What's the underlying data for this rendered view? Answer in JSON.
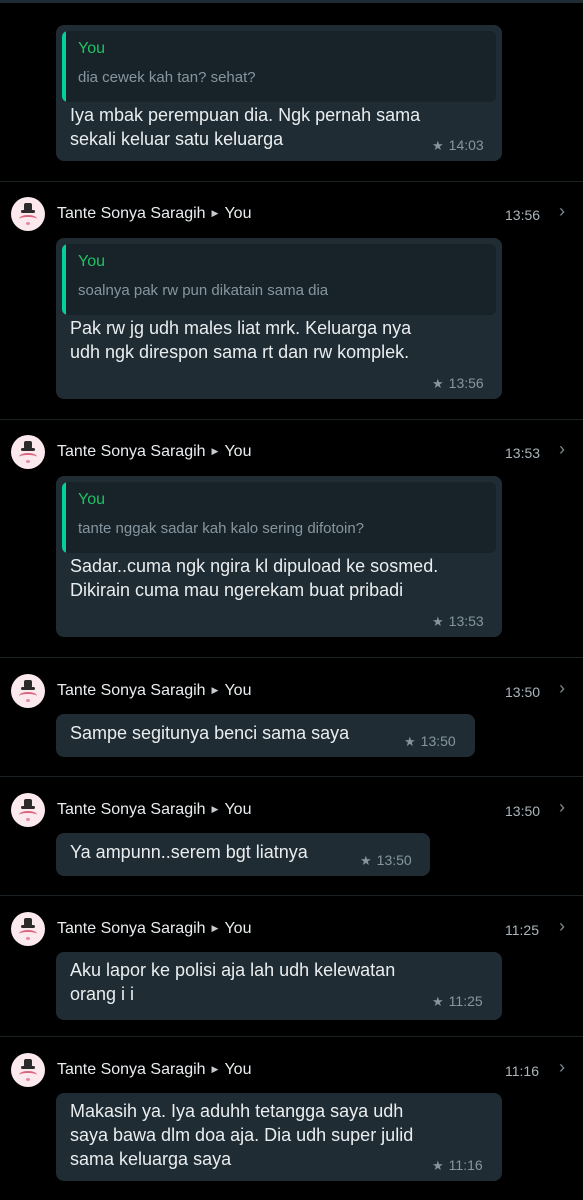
{
  "top_message": {
    "quote_name": "You",
    "quote_text": "dia cewek kah tan? sehat?",
    "text_lines": [
      "Iya mbak perempuan dia. Ngk pernah sama",
      "sekali keluar satu keluarga"
    ],
    "time": "14:03"
  },
  "messages": [
    {
      "sender": "Tante Sonya Saragih",
      "recipient": "You",
      "header_time": "13:56",
      "quote_name": "You",
      "quote_text": "soalnya pak rw pun dikatain sama dia",
      "text_lines": [
        "Pak rw jg udh males liat mrk. Keluarga nya",
        "udh ngk direspon sama rt dan rw komplek."
      ],
      "time": "13:56"
    },
    {
      "sender": "Tante Sonya Saragih",
      "recipient": "You",
      "header_time": "13:53",
      "quote_name": "You",
      "quote_text": "tante nggak sadar kah kalo sering difotoin?",
      "text_lines": [
        "Sadar..cuma ngk ngira kl dipuload ke sosmed.",
        "Dikirain cuma mau ngerekam buat pribadi"
      ],
      "time": "13:53"
    },
    {
      "sender": "Tante Sonya Saragih",
      "recipient": "You",
      "header_time": "13:50",
      "text_lines": [
        "Sampe segitunya benci sama saya"
      ],
      "time": "13:50"
    },
    {
      "sender": "Tante Sonya Saragih",
      "recipient": "You",
      "header_time": "13:50",
      "text_lines": [
        "Ya ampunn..serem bgt liatnya"
      ],
      "time": "13:50"
    },
    {
      "sender": "Tante Sonya Saragih",
      "recipient": "You",
      "header_time": "11:25",
      "text_lines": [
        "Aku lapor ke polisi aja lah udh kelewatan",
        "orang i i"
      ],
      "time": "11:25"
    },
    {
      "sender": "Tante Sonya Saragih",
      "recipient": "You",
      "header_time": "11:16",
      "text_lines": [
        "Makasih ya. Iya aduhh tetangga saya udh",
        "saya bawa dlm doa aja. Dia udh super julid",
        "sama keluarga saya"
      ],
      "time": "11:16"
    }
  ],
  "icons": {
    "star": "star-icon",
    "chevron": "chevron-right-icon",
    "arrow": "play-arrow-icon"
  },
  "colors": {
    "background": "#000000",
    "bubble": "#1f2c33",
    "quote_bar": "#06cf9c",
    "quote_name": "#21c063",
    "secondary_text": "#8696a0"
  }
}
